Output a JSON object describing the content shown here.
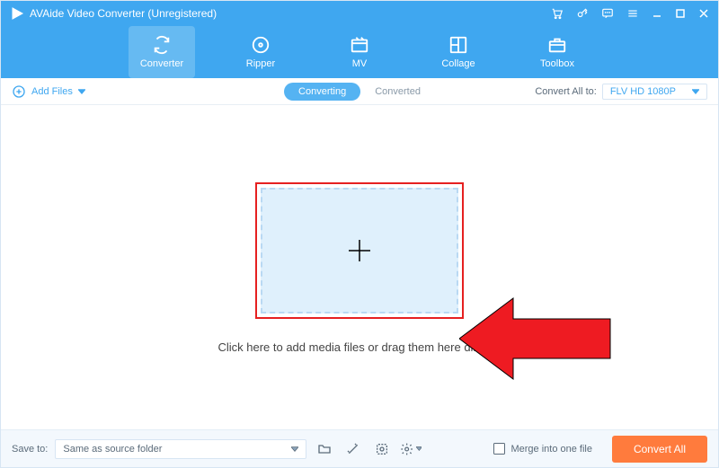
{
  "title": "AVAide Video Converter (Unregistered)",
  "nav": {
    "converter": "Converter",
    "ripper": "Ripper",
    "mv": "MV",
    "collage": "Collage",
    "toolbox": "Toolbox"
  },
  "subbar": {
    "add_files": "Add Files",
    "converting": "Converting",
    "converted": "Converted",
    "convert_all_to_label": "Convert All to:",
    "format_selected": "FLV HD 1080P"
  },
  "main": {
    "hint": "Click here to add media files or drag them here directly"
  },
  "footer": {
    "saveto_label": "Save to:",
    "saveto_value": "Same as source folder",
    "merge_label": "Merge into one file",
    "convert_all_btn": "Convert All"
  }
}
